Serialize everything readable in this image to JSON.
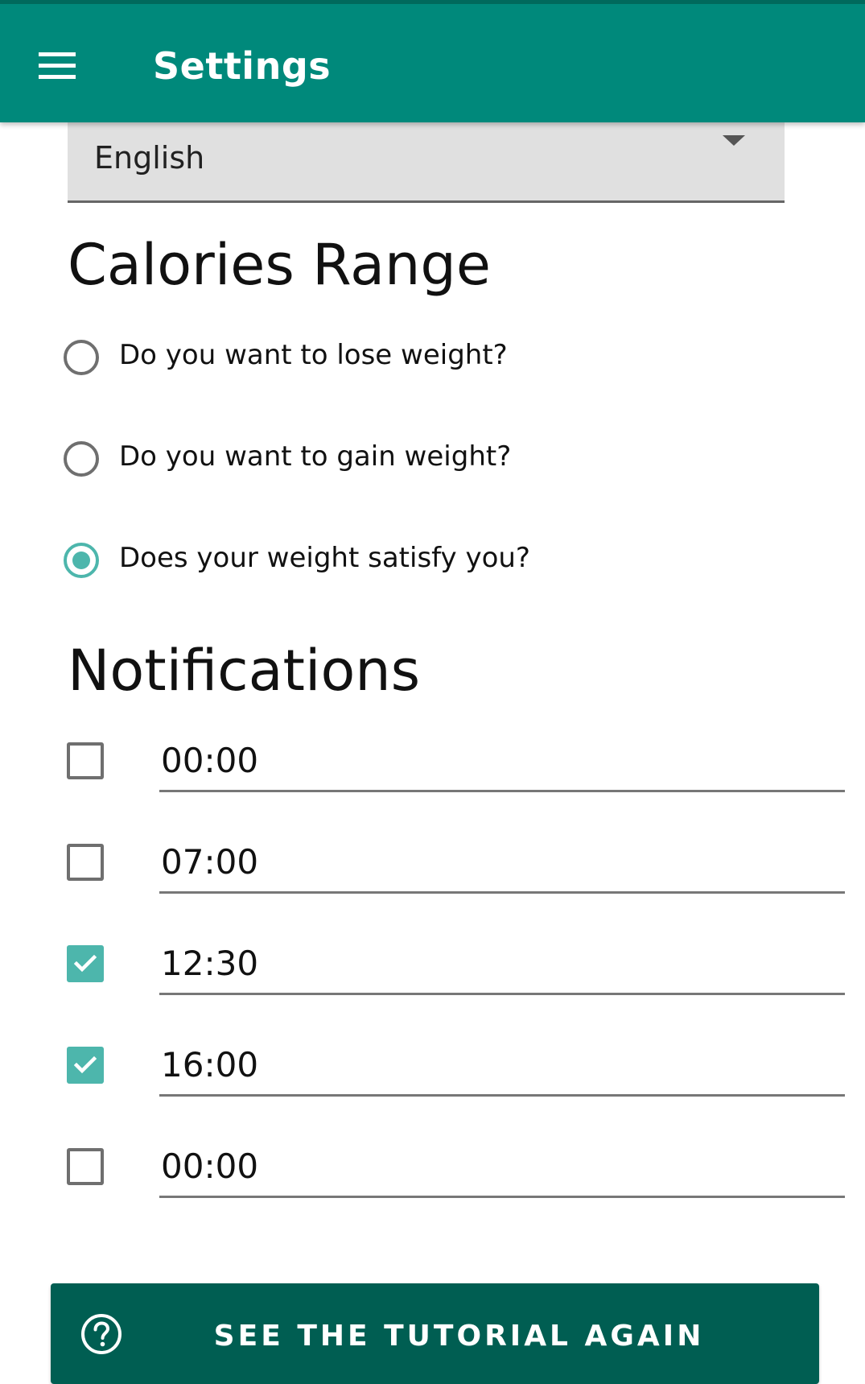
{
  "colors": {
    "app_bar": "#00897b",
    "accent": "#4db6ac",
    "button": "#005e52"
  },
  "header": {
    "title": "Settings",
    "menu_icon": "menu-icon"
  },
  "language": {
    "selected": "English"
  },
  "calories": {
    "title": "Calories Range",
    "options": [
      {
        "label": "Do you want to lose weight?",
        "checked": false
      },
      {
        "label": "Do you want to gain weight?",
        "checked": false
      },
      {
        "label": "Does your weight satisfy you?",
        "checked": true
      }
    ]
  },
  "notifications": {
    "title": "Notifications",
    "items": [
      {
        "time": "00:00",
        "enabled": false
      },
      {
        "time": "07:00",
        "enabled": false
      },
      {
        "time": "12:30",
        "enabled": true
      },
      {
        "time": "16:00",
        "enabled": true
      },
      {
        "time": "00:00",
        "enabled": false
      }
    ]
  },
  "tutorial": {
    "label": "SEE THE TUTORIAL AGAIN",
    "icon": "help-circle-icon"
  }
}
